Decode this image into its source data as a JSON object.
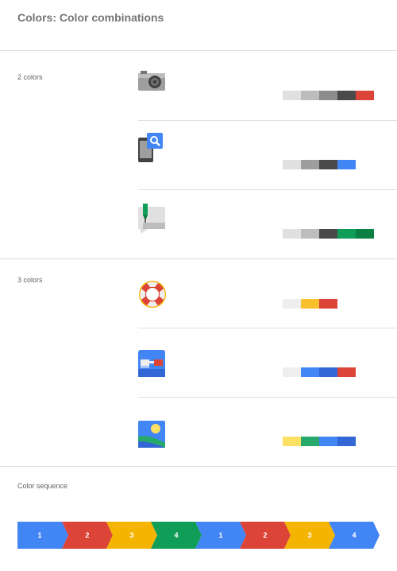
{
  "page": {
    "title": "Colors: Color combinations"
  },
  "sections": {
    "two_colors": "2 colors",
    "three_colors": "3 colors",
    "sequence": "Color sequence"
  },
  "combinations": [
    {
      "icon": "camera-icon",
      "swatches": [
        "#e0e0e0",
        "#bdbdbd",
        "#8c8c8c",
        "#4a4a4a",
        "#db4437"
      ]
    },
    {
      "icon": "phone-search-icon",
      "swatches": [
        "#e0e0e0",
        "#9e9e9e",
        "#4a4a4a",
        "#4285f4"
      ]
    },
    {
      "icon": "chat-edit-icon",
      "swatches": [
        "#e0e0e0",
        "#bdbdbd",
        "#4a4a4a",
        "#0f9d58",
        "#0b8043"
      ]
    },
    {
      "icon": "lifebuoy-icon",
      "swatches": [
        "#eeeeee",
        "#fbc02d",
        "#db4437"
      ]
    },
    {
      "icon": "glasses-icon",
      "swatches": [
        "#eeeeee",
        "#4285f4",
        "#3367d6",
        "#db4437"
      ]
    },
    {
      "icon": "photos-icon",
      "swatches": [
        "#fbe063",
        "#27a96c",
        "#4285f4",
        "#3367d6"
      ]
    }
  ],
  "sequence": [
    {
      "label": "1",
      "color": "#4285f4"
    },
    {
      "label": "2",
      "color": "#db4437"
    },
    {
      "label": "3",
      "color": "#f4b400"
    },
    {
      "label": "4",
      "color": "#0f9d58"
    },
    {
      "label": "1",
      "color": "#4285f4"
    },
    {
      "label": "2",
      "color": "#db4437"
    },
    {
      "label": "3",
      "color": "#f4b400"
    },
    {
      "label": "4",
      "color": "#4285f4"
    }
  ]
}
